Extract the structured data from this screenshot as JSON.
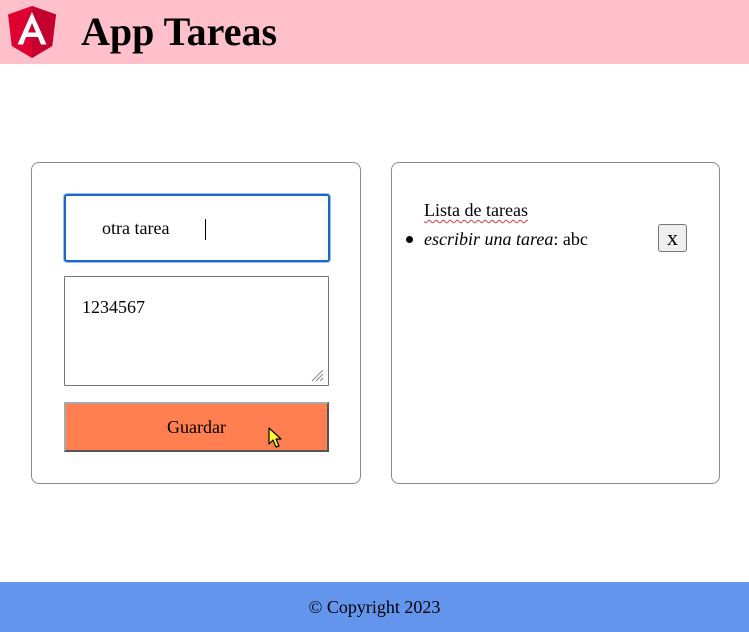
{
  "header": {
    "logo_icon": "angular-logo-icon",
    "title": "App Tareas",
    "background": "#ffc0cb"
  },
  "form": {
    "title_input_value": "otra tarea",
    "description_value": "1234567",
    "save_label": "Guardar",
    "save_color": "#ff7f50"
  },
  "task_list": {
    "heading": "Lista de tareas",
    "items": [
      {
        "title": "escribir una tarea",
        "separator": ":",
        "description": " abc",
        "delete_label": "x"
      }
    ]
  },
  "footer": {
    "text": "© Copyright 2023",
    "background": "#6495ed"
  }
}
